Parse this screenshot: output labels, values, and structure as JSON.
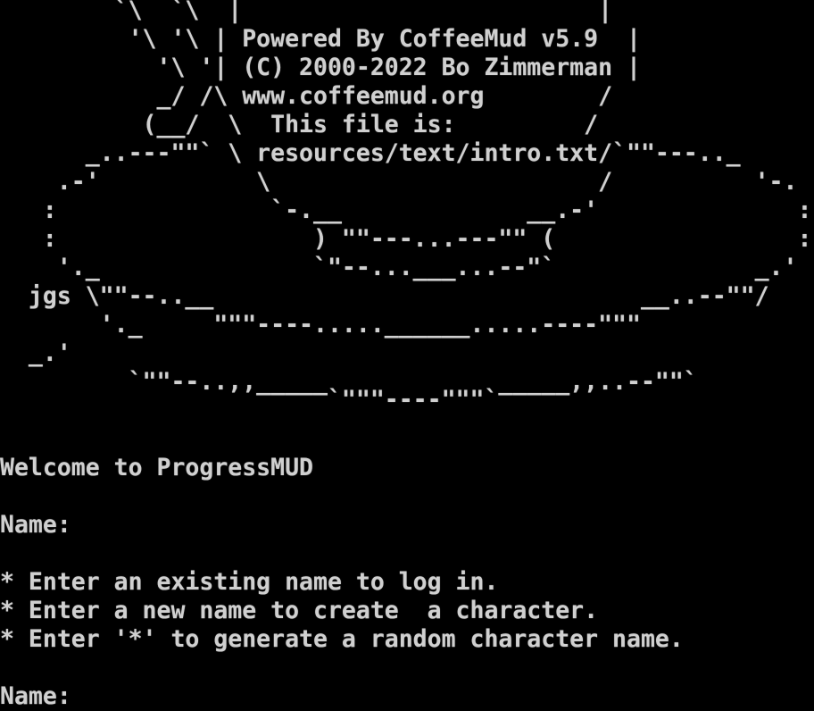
{
  "terminal": {
    "background": "#000000",
    "foreground": "#d0d0d0",
    "banner_lines": [
      "        `\\  `\\  |                         |",
      "         '\\ '\\ | Powered By CoffeeMud v5.9  |",
      "           '\\ '| (C) 2000-2022 Bo Zimmerman |",
      "           _/ /\\ www.coffeemud.org        /",
      "          (__/  \\  This file is:         /",
      "      _..---\"\"` \\ resources/text/intro.txt/`\"\"---.._",
      "    .-'           \\                       /          '-.",
      "   :               `-.__             __.-'              :",
      "   :                  ) \"\"---...---\"\" (                 :",
      "    '._               `\"--...___...--\"`              _.'",
      "  jgs \\\"\"--..__                              __..--\"\"/",
      "       '._     \"\"\"----.....______.....----\"\"\"",
      "  _.'",
      "         `\"\"--..,,_____            _____,,..--\"\"`",
      "                       `\"\"\"----\"\"\"`"
    ],
    "welcome": "Welcome to ProgressMUD",
    "name_prompt_1": "Name:",
    "help_lines": [
      "* Enter an existing name to log in.",
      "* Enter a new name to create  a character.",
      "* Enter '*' to generate a random character name."
    ],
    "name_prompt_2": "Name:"
  }
}
